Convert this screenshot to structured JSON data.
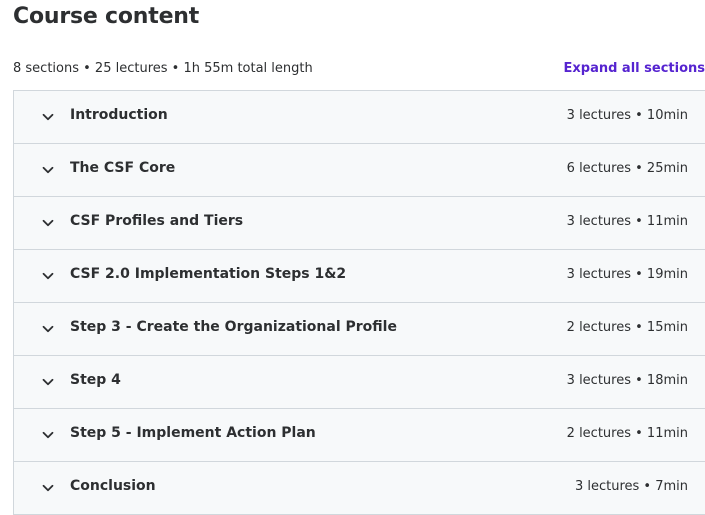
{
  "header": {
    "title": "Course content",
    "summary": "8 sections • 25 lectures • 1h 55m total length",
    "expand_label": "Expand all sections"
  },
  "sections": [
    {
      "title": "Introduction",
      "meta": "3 lectures • 10min",
      "icon": "chevron-down-icon"
    },
    {
      "title": "The CSF Core",
      "meta": "6 lectures • 25min",
      "icon": "chevron-down-icon"
    },
    {
      "title": "CSF Profiles and Tiers",
      "meta": "3 lectures • 11min",
      "icon": "chevron-down-icon"
    },
    {
      "title": "CSF 2.0 Implementation Steps 1&2",
      "meta": "3 lectures • 19min",
      "icon": "chevron-down-icon"
    },
    {
      "title": "Step 3 - Create the Organizational Profile",
      "meta": "2 lectures • 15min",
      "icon": "chevron-down-icon"
    },
    {
      "title": "Step 4",
      "meta": "3 lectures • 18min",
      "icon": "chevron-down-icon"
    },
    {
      "title": "Step 5 - Implement Action Plan",
      "meta": "2 lectures • 11min",
      "icon": "chevron-down-icon"
    },
    {
      "title": "Conclusion",
      "meta": "3 lectures • 7min",
      "icon": "chevron-down-icon"
    }
  ],
  "colors": {
    "accent": "#5624d0",
    "text": "#2d2f31",
    "section_bg": "#f7f9fa",
    "border": "#d1d7dc"
  }
}
